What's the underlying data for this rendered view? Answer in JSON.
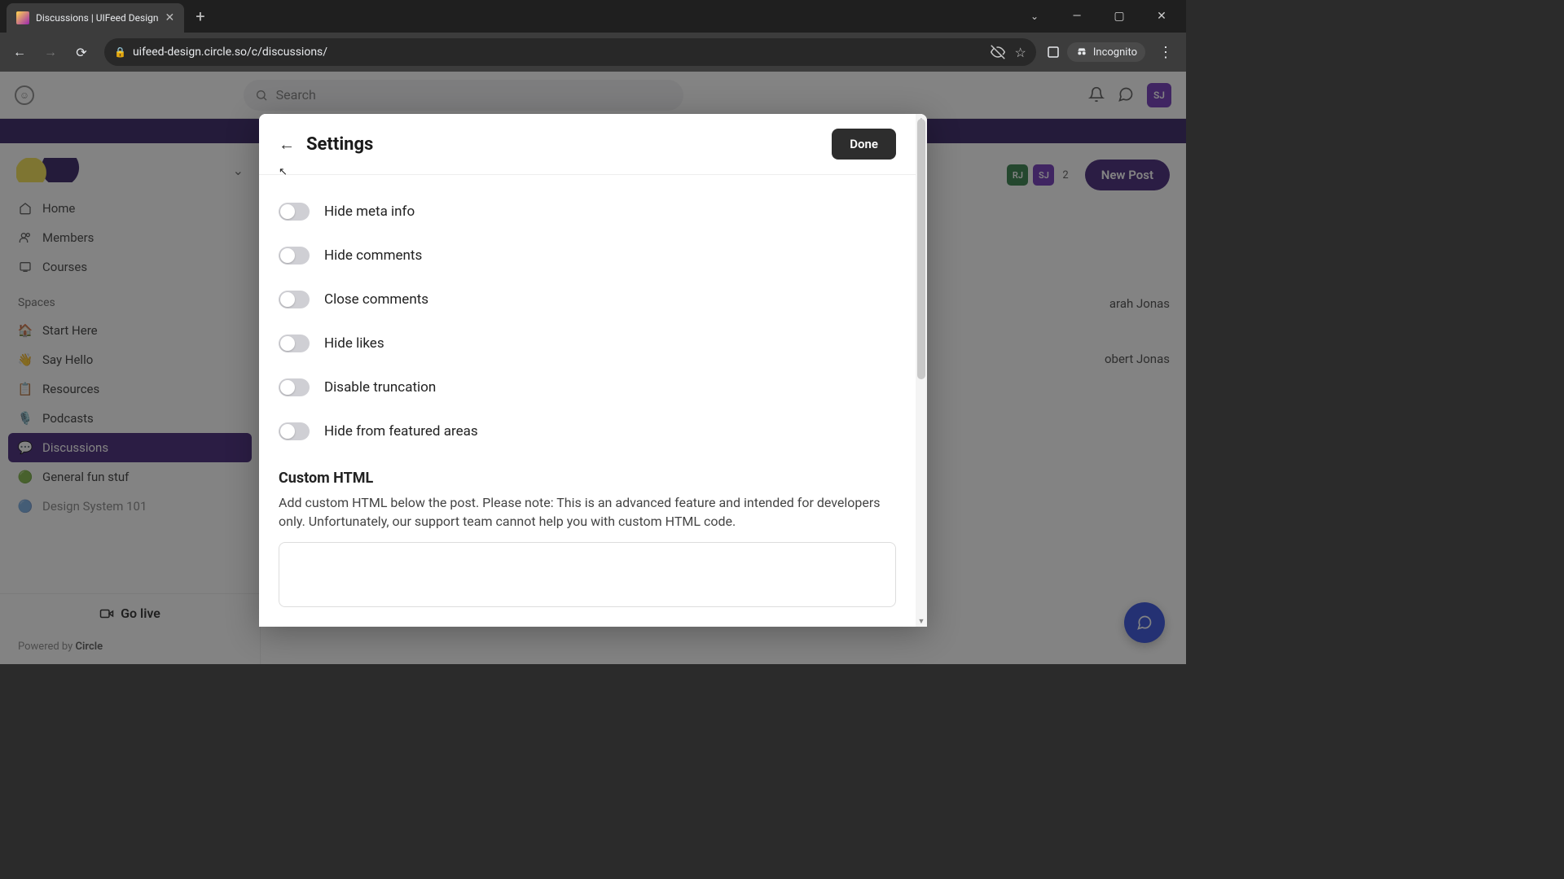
{
  "browser": {
    "tab_title": "Discussions | UIFeed Design",
    "url": "uifeed-design.circle.so/c/discussions/",
    "incognito_label": "Incognito"
  },
  "header": {
    "search_placeholder": "Search",
    "avatar_initials": "SJ"
  },
  "sidebar": {
    "nav": [
      {
        "icon": "home",
        "label": "Home"
      },
      {
        "icon": "members",
        "label": "Members"
      },
      {
        "icon": "courses",
        "label": "Courses"
      }
    ],
    "section_label": "Spaces",
    "spaces": [
      {
        "emoji": "🏠",
        "label": "Start Here"
      },
      {
        "emoji": "👋",
        "label": "Say Hello"
      },
      {
        "emoji": "📋",
        "label": "Resources"
      },
      {
        "emoji": "🎙️",
        "label": "Podcasts"
      },
      {
        "emoji": "💬",
        "label": "Discussions",
        "active": true
      },
      {
        "emoji": "🟢",
        "label": "General fun stuf"
      },
      {
        "emoji": "🔵",
        "label": "Design System 101"
      }
    ],
    "go_live": "Go live",
    "powered_prefix": "Powered by ",
    "powered_brand": "Circle"
  },
  "right": {
    "avatars": [
      "RJ",
      "SJ"
    ],
    "extra_count": "2",
    "new_post": "New Post",
    "members_partial_1": "arah Jonas",
    "members_partial_2": "obert Jonas"
  },
  "modal": {
    "title": "Settings",
    "done": "Done",
    "toggles": [
      "Hide meta info",
      "Hide comments",
      "Close comments",
      "Hide likes",
      "Disable truncation",
      "Hide from featured areas"
    ],
    "custom_title": "Custom HTML",
    "custom_desc": "Add custom HTML below the post. Please note: This is an advanced feature and intended for developers only. Unfortunately, our support team cannot help you with custom HTML code."
  }
}
